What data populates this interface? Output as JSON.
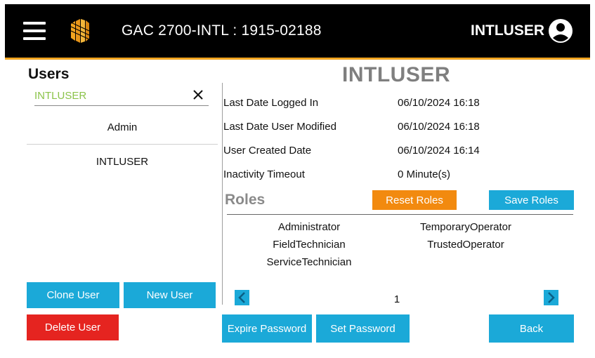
{
  "header": {
    "title": "GAC 2700-INTL : 1915-02188",
    "current_user": "INTLUSER"
  },
  "users_panel": {
    "title": "Users",
    "search": {
      "value": "INTLUSER",
      "placeholder": ""
    },
    "users": [
      "Admin",
      "INTLUSER"
    ],
    "buttons": {
      "clone": "Clone User",
      "new": "New User",
      "delete": "Delete User"
    }
  },
  "details": {
    "username": "INTLUSER",
    "fields": [
      {
        "label": "Last Date Logged In",
        "value": "06/10/2024 16:18"
      },
      {
        "label": "Last Date User Modified",
        "value": "06/10/2024 16:18"
      },
      {
        "label": "User Created Date",
        "value": "06/10/2024 16:14"
      },
      {
        "label": "Inactivity Timeout",
        "value": "0 Minute(s)"
      }
    ],
    "roles_title": "Roles",
    "reset_roles": "Reset Roles",
    "save_roles": "Save Roles",
    "roles": [
      "Administrator",
      "TemporaryOperator",
      "FieldTechnician",
      "TrustedOperator",
      "ServiceTechnician"
    ],
    "page": "1",
    "buttons": {
      "expire_password": "Expire Password",
      "set_password": "Set Password",
      "back": "Back"
    }
  },
  "colors": {
    "accent_blue": "#1BA9D8",
    "danger_red": "#E52420",
    "warning_orange": "#F28A0F",
    "header_accent": "#F2A41F",
    "search_text_green": "#8BC34A"
  },
  "icons": [
    "menu-icon",
    "logo-icon",
    "user-avatar-icon",
    "close-icon",
    "chevron-left-icon",
    "chevron-right-icon"
  ]
}
